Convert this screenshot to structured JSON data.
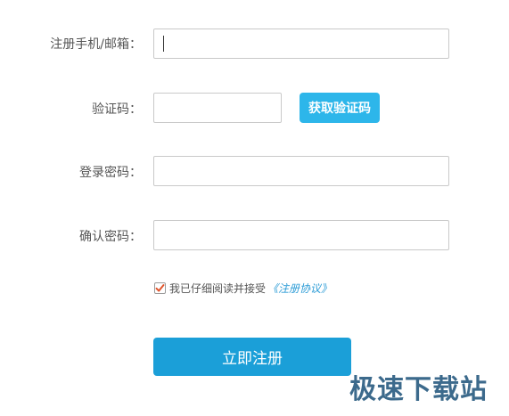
{
  "form": {
    "phone_email_label": "注册手机/邮箱：",
    "phone_email_value": "",
    "verify_code_label": "验证码：",
    "verify_code_value": "",
    "get_code_button": "获取验证码",
    "password_label": "登录密码：",
    "password_value": "",
    "confirm_password_label": "确认密码：",
    "confirm_password_value": "",
    "agree_text": "我已仔细阅读并接受",
    "agree_link": "《注册协议》",
    "agree_checked": true,
    "submit_button": "立即注册"
  },
  "watermark": {
    "text": "极速下载站"
  },
  "colors": {
    "accent": "#1b9fd8",
    "code_button": "#2db6ea",
    "checkbox_mark": "#e0552d",
    "link": "#2a9bd6",
    "watermark": "#3c6a8c"
  }
}
